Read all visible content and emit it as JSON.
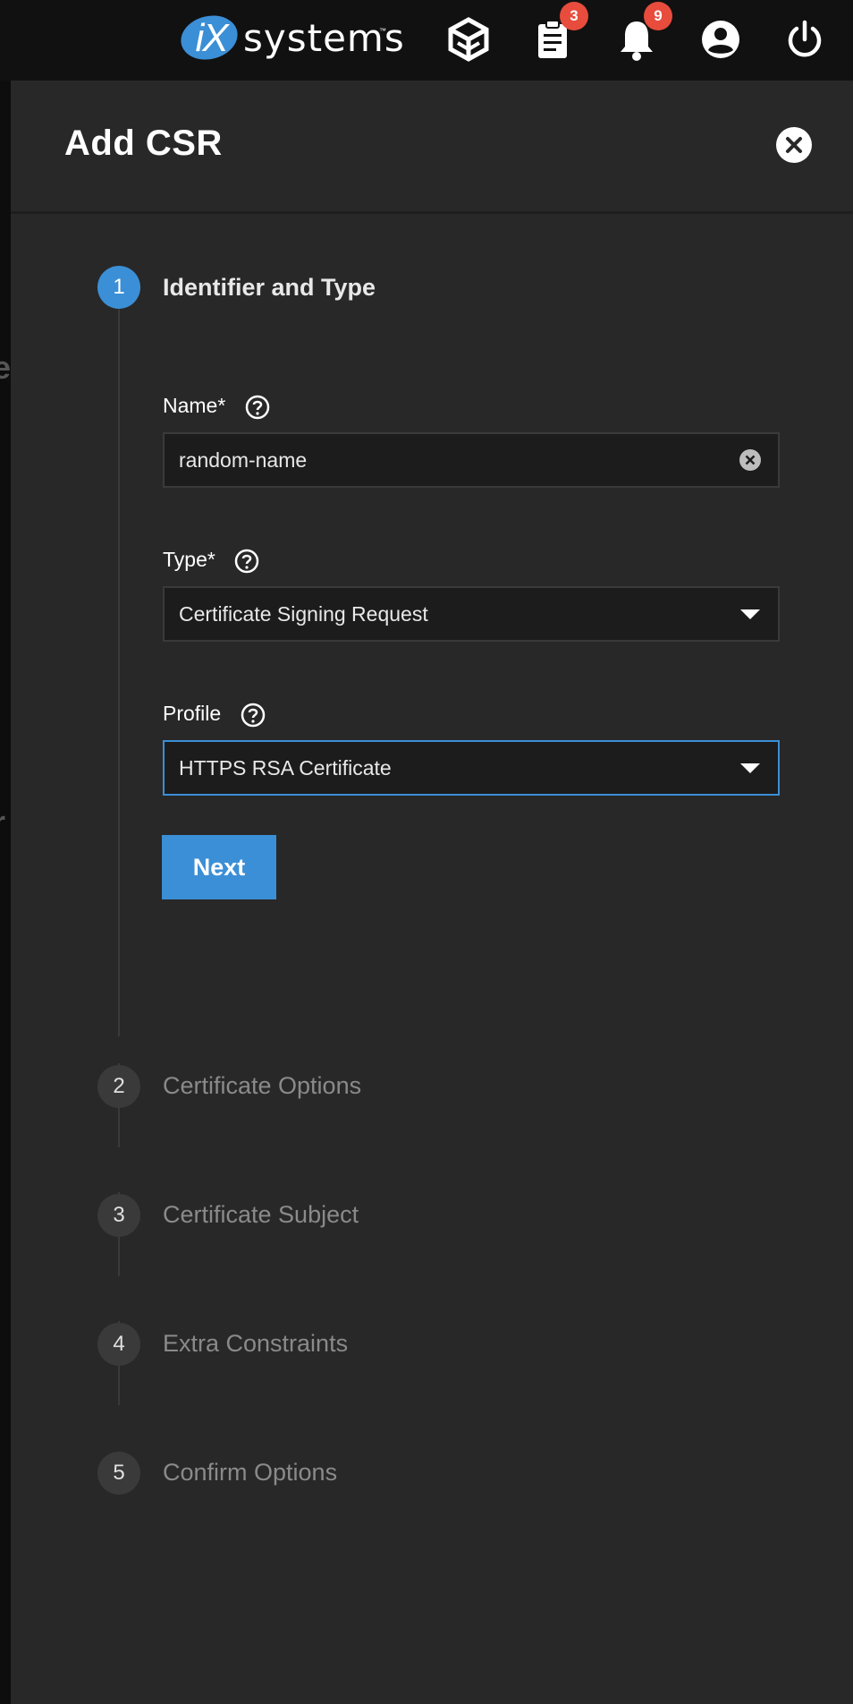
{
  "topbar": {
    "logo_text": "systems",
    "logo_mark": "iX",
    "logo_tm": "™",
    "icons": [
      {
        "name": "truecommand-icon"
      },
      {
        "name": "tasks-icon",
        "badge": "3"
      },
      {
        "name": "bell-icon",
        "badge": "9"
      },
      {
        "name": "account-circle-icon"
      },
      {
        "name": "power-icon"
      }
    ]
  },
  "background": {
    "glyph_1": "es",
    "glyph_2": "r"
  },
  "panel": {
    "title": "Add CSR",
    "close_icon": "close-circle-icon"
  },
  "stepper": {
    "steps": [
      {
        "number": "1",
        "label": "Identifier and Type",
        "active": true
      },
      {
        "number": "2",
        "label": "Certificate Options",
        "active": false
      },
      {
        "number": "3",
        "label": "Certificate Subject",
        "active": false
      },
      {
        "number": "4",
        "label": "Extra Constraints",
        "active": false
      },
      {
        "number": "5",
        "label": "Confirm Options",
        "active": false
      }
    ]
  },
  "form": {
    "name": {
      "label": "Name",
      "required": "*",
      "value": "random-name"
    },
    "type": {
      "label": "Type",
      "required": "*",
      "value": "Certificate Signing Request"
    },
    "profile": {
      "label": "Profile",
      "value": "HTTPS RSA Certificate"
    },
    "next_label": "Next"
  },
  "colors": {
    "accent": "#3b8fd6",
    "badge": "#e74c3c",
    "panel_bg": "#282828",
    "topbar_bg": "#111111"
  }
}
